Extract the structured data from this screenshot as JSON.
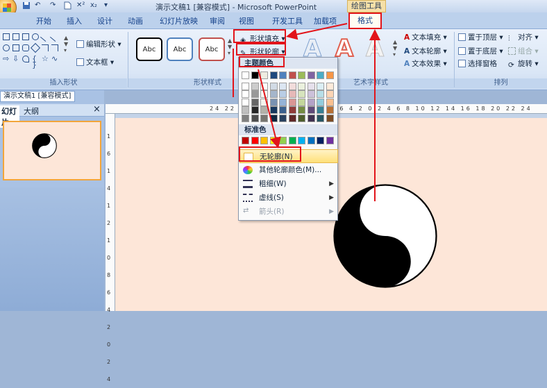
{
  "titlebar": {
    "window_title": "演示文稿1 [兼容模式] - Microsoft PowerPoint",
    "contextual_title": "绘图工具",
    "qat": [
      "↶",
      "↷",
      "✕²",
      "x₂",
      "▾"
    ]
  },
  "tabs": [
    "开始",
    "插入",
    "设计",
    "动画",
    "幻灯片放映",
    "审阅",
    "视图",
    "开发工具",
    "加载项",
    "格式"
  ],
  "ribbon": {
    "insert_shapes": {
      "edit_shape": "编辑形状",
      "textbox": "文本框",
      "label": "插入形状"
    },
    "shape_styles": {
      "style_sample": "Abc",
      "shape_fill": "形状填充",
      "shape_outline": "形状轮廓",
      "label": "形状样式"
    },
    "wordart": {
      "letter": "A",
      "text_fill": "文本填充",
      "text_outline": "文本轮廓",
      "text_effects": "文本效果",
      "label": "艺术字样式"
    },
    "arrange": {
      "bring_front": "置于顶层",
      "send_back": "置于底层",
      "selection_pane": "选择窗格",
      "align": "对齐",
      "group": "组合",
      "rotate": "旋转",
      "label": "排列"
    }
  },
  "left_panel": {
    "doc_tab": "演示文稿1 [兼容模式]",
    "tab_slides": "幻灯片",
    "tab_outline": "大纲",
    "close": "×",
    "slide_number": "1"
  },
  "ruler": {
    "top": "24 22 20 18 16 14 12 10 8 6 4 2 0 2 4 6 8 10 12 14 16 18 20 22 24",
    "left": "16 14 12 10 8 6 4 2 0 2 4"
  },
  "dropdown": {
    "theme_colors": "主题颜色",
    "standard_colors": "标准色",
    "no_outline": "无轮廓(N)",
    "more_colors": "其他轮廓颜色(M)...",
    "weight": "粗细(W)",
    "dashes": "虚线(S)",
    "arrows": "箭头(R)",
    "theme_top_row": [
      "#ffffff",
      "#000000",
      "#eeece1",
      "#1f497d",
      "#4f81bd",
      "#c0504d",
      "#9bbb59",
      "#8064a2",
      "#4bacc6",
      "#f79646"
    ],
    "standard_row": [
      "#c00000",
      "#ff0000",
      "#ffc000",
      "#ffff00",
      "#92d050",
      "#00b050",
      "#00b0f0",
      "#0070c0",
      "#002060",
      "#7030a0"
    ]
  },
  "colors": {
    "annotation": "#e2141a",
    "slide_bg": "#fde6d8"
  }
}
